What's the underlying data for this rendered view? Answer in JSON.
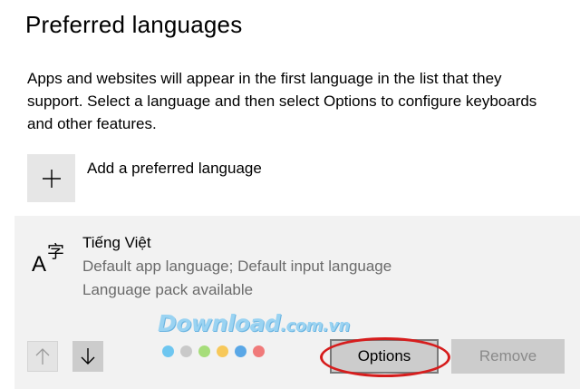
{
  "page": {
    "title": "Preferred languages",
    "description": "Apps and websites will appear in the first language in the list that they support. Select a language and then select Options to configure keyboards and other features."
  },
  "add_language": {
    "label": "Add a preferred language",
    "icon": "plus-icon"
  },
  "language_item": {
    "icon": "language-glyph-icon",
    "name": "Tiếng Việt",
    "details": [
      "Default app language; Default input language",
      "Language pack available"
    ],
    "buttons": {
      "options": "Options",
      "remove": "Remove"
    },
    "move_up_icon": "arrow-up-icon",
    "move_down_icon": "arrow-down-icon"
  },
  "watermark": {
    "brand": "Download",
    "suffix": ".com.vn",
    "dot_colors": [
      "#6ec6f0",
      "#c9c9c9",
      "#a6dd7a",
      "#f7c85a",
      "#5aa7e6",
      "#f07a7a"
    ]
  },
  "colors": {
    "highlight_ring": "#d61d1d",
    "panel_bg": "#f2f2f2",
    "button_bg": "#cccccc"
  }
}
